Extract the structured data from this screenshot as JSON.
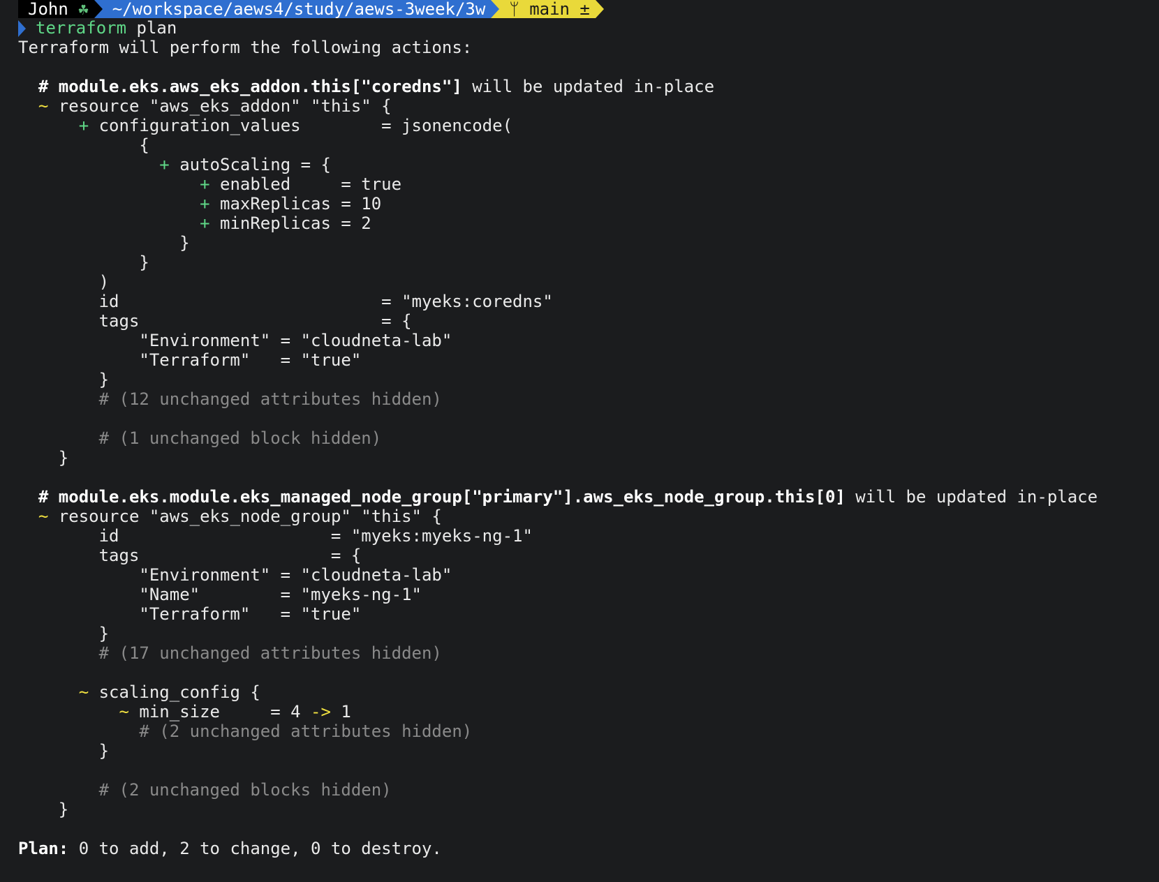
{
  "prompt": {
    "user": "John",
    "user_icon": "clover-icon",
    "path": "~/workspace/aews4/study/aews-3week/3w",
    "branch_icon": "git-branch-icon",
    "branch": "main ±"
  },
  "command": {
    "program": "terraform",
    "args": " plan"
  },
  "output": {
    "intro": "Terraform will perform the following actions:",
    "res1_header_addr": "# module.eks.aws_eks_addon.this[\"coredns\"]",
    "res1_header_action": " will be updated in-place",
    "res1_tilde": "~",
    "res1_resource": " resource \"aws_eks_addon\" \"this\" {",
    "res1_plus1": "+",
    "res1_config": " configuration_values        = jsonencode(",
    "res1_open1": "{",
    "res1_plus2": "+",
    "res1_autoscaling": " autoScaling = {",
    "res1_plus3": "+",
    "res1_enabled": " enabled     = true",
    "res1_plus4": "+",
    "res1_max": " maxReplicas = 10",
    "res1_plus5": "+",
    "res1_min": " minReplicas = 2",
    "res1_close1": "}",
    "res1_close2": "}",
    "res1_close3": ")",
    "res1_id": "id                          = \"myeks:coredns\"",
    "res1_tags": "tags                        = {",
    "res1_tag_env": "\"Environment\" = \"cloudneta-lab\"",
    "res1_tag_tf": "\"Terraform\"   = \"true\"",
    "res1_tags_close": "}",
    "res1_hidden_attrs": "# (12 unchanged attributes hidden)",
    "res1_hidden_block": "# (1 unchanged block hidden)",
    "res1_close": "}",
    "res2_header_addr": "# module.eks.module.eks_managed_node_group[\"primary\"].aws_eks_node_group.this[0]",
    "res2_header_action": " will be updated in-place",
    "res2_tilde": "~",
    "res2_resource": " resource \"aws_eks_node_group\" \"this\" {",
    "res2_id": "id                     = \"myeks:myeks-ng-1\"",
    "res2_tags": "tags                   = {",
    "res2_tag_env": "\"Environment\" = \"cloudneta-lab\"",
    "res2_tag_name": "\"Name\"        = \"myeks-ng-1\"",
    "res2_tag_tf": "\"Terraform\"   = \"true\"",
    "res2_tags_close": "}",
    "res2_hidden_attrs": "# (17 unchanged attributes hidden)",
    "res2_scaling_tilde": "~",
    "res2_scaling": " scaling_config {",
    "res2_min_tilde": "~",
    "res2_min_size": " min_size     = 4 ",
    "res2_arrow": "->",
    "res2_min_new": " 1",
    "res2_scaling_hidden": "# (2 unchanged attributes hidden)",
    "res2_scaling_close": "}",
    "res2_hidden_blocks": "# (2 unchanged blocks hidden)",
    "res2_close": "}",
    "plan_label": "Plan:",
    "plan_summary": " 0 to add, 2 to change, 0 to destroy."
  },
  "colors": {
    "background": "#1b1c1e",
    "add": "#5fd787",
    "change": "#f0e040",
    "comment": "#8a8a8a",
    "path_segment": "#2f6fd0",
    "git_segment": "#e9d93a"
  }
}
